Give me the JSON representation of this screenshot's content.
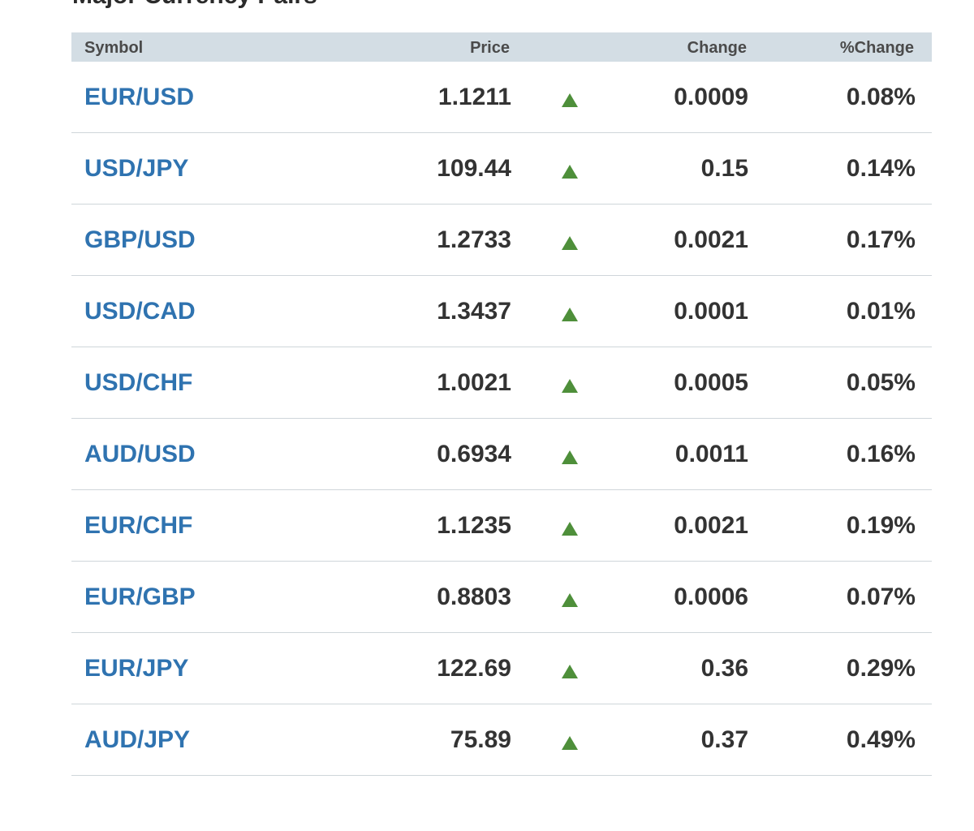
{
  "section": {
    "title": "Major Currency Pairs"
  },
  "table": {
    "headers": {
      "symbol": "Symbol",
      "price": "Price",
      "change": "Change",
      "pct_change": "%Change"
    },
    "rows": [
      {
        "symbol": "EUR/USD",
        "price": "1.1211",
        "direction": "up",
        "change": "0.0009",
        "pct_change": "0.08%"
      },
      {
        "symbol": "USD/JPY",
        "price": "109.44",
        "direction": "up",
        "change": "0.15",
        "pct_change": "0.14%"
      },
      {
        "symbol": "GBP/USD",
        "price": "1.2733",
        "direction": "up",
        "change": "0.0021",
        "pct_change": "0.17%"
      },
      {
        "symbol": "USD/CAD",
        "price": "1.3437",
        "direction": "up",
        "change": "0.0001",
        "pct_change": "0.01%"
      },
      {
        "symbol": "USD/CHF",
        "price": "1.0021",
        "direction": "up",
        "change": "0.0005",
        "pct_change": "0.05%"
      },
      {
        "symbol": "AUD/USD",
        "price": "0.6934",
        "direction": "up",
        "change": "0.0011",
        "pct_change": "0.16%"
      },
      {
        "symbol": "EUR/CHF",
        "price": "1.1235",
        "direction": "up",
        "change": "0.0021",
        "pct_change": "0.19%"
      },
      {
        "symbol": "EUR/GBP",
        "price": "0.8803",
        "direction": "up",
        "change": "0.0006",
        "pct_change": "0.07%"
      },
      {
        "symbol": "EUR/JPY",
        "price": "122.69",
        "direction": "up",
        "change": "0.36",
        "pct_change": "0.29%"
      },
      {
        "symbol": "AUD/JPY",
        "price": "75.89",
        "direction": "up",
        "change": "0.37",
        "pct_change": "0.49%"
      }
    ]
  },
  "colors": {
    "symbol_link": "#2f73b0",
    "up_arrow": "#4e8f3a",
    "header_bg": "#d3dde4",
    "row_divider": "#cfd6da"
  },
  "icons": {
    "direction_up": "up-triangle-icon"
  }
}
